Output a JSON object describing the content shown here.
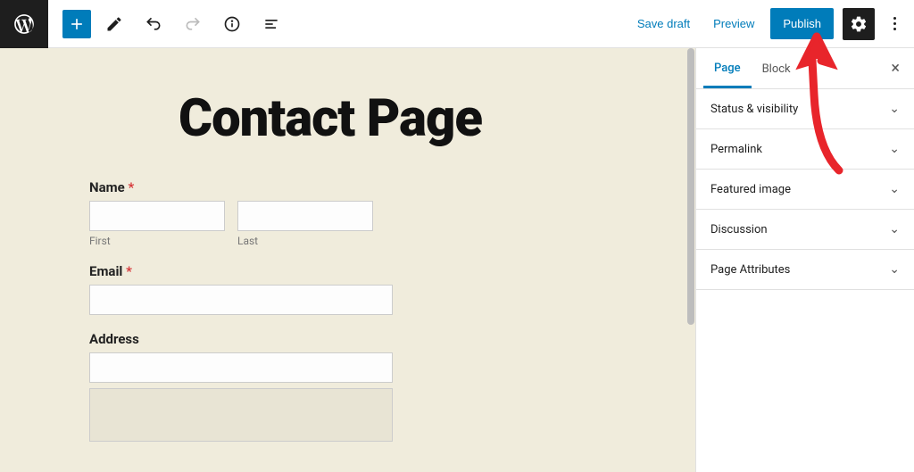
{
  "header": {
    "save_draft": "Save draft",
    "preview": "Preview",
    "publish": "Publish"
  },
  "canvas": {
    "title": "Contact Page",
    "form": {
      "name_label": "Name",
      "first_sub": "First",
      "last_sub": "Last",
      "email_label": "Email",
      "address_label": "Address",
      "required_mark": "*"
    }
  },
  "sidebar": {
    "tabs": {
      "page": "Page",
      "block": "Block"
    },
    "panels": [
      "Status & visibility",
      "Permalink",
      "Featured image",
      "Discussion",
      "Page Attributes"
    ]
  }
}
